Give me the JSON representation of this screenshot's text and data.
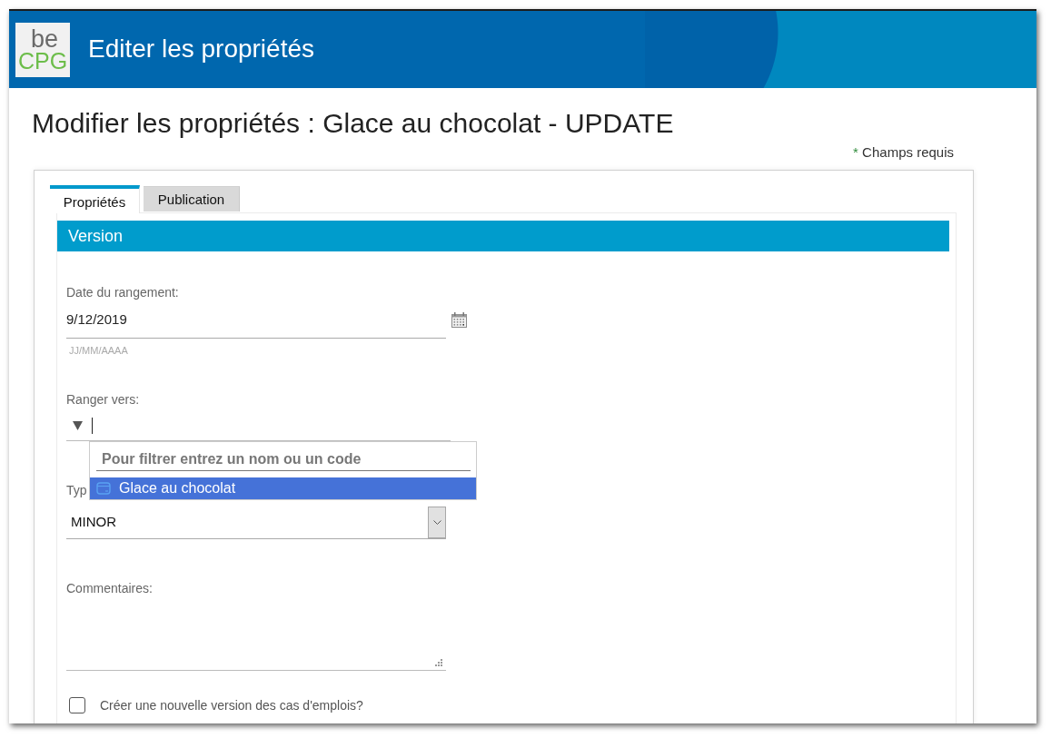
{
  "window": {
    "title": "Editer les propriétés"
  },
  "logo": {
    "lines": [
      "be",
      "CPG"
    ]
  },
  "page": {
    "heading": "Modifier les propriétés : Glace au chocolat - UPDATE",
    "required_note": {
      "marker": "*",
      "text": "Champs requis"
    }
  },
  "tabs": [
    {
      "label": "Propriétés",
      "selected": true
    },
    {
      "label": "Publication",
      "selected": false
    }
  ],
  "section": {
    "title": "Version"
  },
  "fields": [
    {
      "kind": "date",
      "label": "Date du rangement:",
      "value": "9/12/2019",
      "hint": "JJ/MM/AAAA"
    },
    {
      "kind": "picker",
      "label": "Ranger vers:",
      "expanded": true,
      "dropdown": {
        "placeholder": "Pour filtrer entrez un nom ou un code",
        "options": [
          {
            "label": "Glace au chocolat",
            "selected": true
          }
        ]
      }
    },
    {
      "kind": "select",
      "label": "Typ",
      "value": "MINOR"
    },
    {
      "kind": "textarea",
      "label": "Commentaires:"
    },
    {
      "kind": "checkbox",
      "label": "Créer une nouvelle version des cas d'emplois?",
      "checked": false
    }
  ]
}
